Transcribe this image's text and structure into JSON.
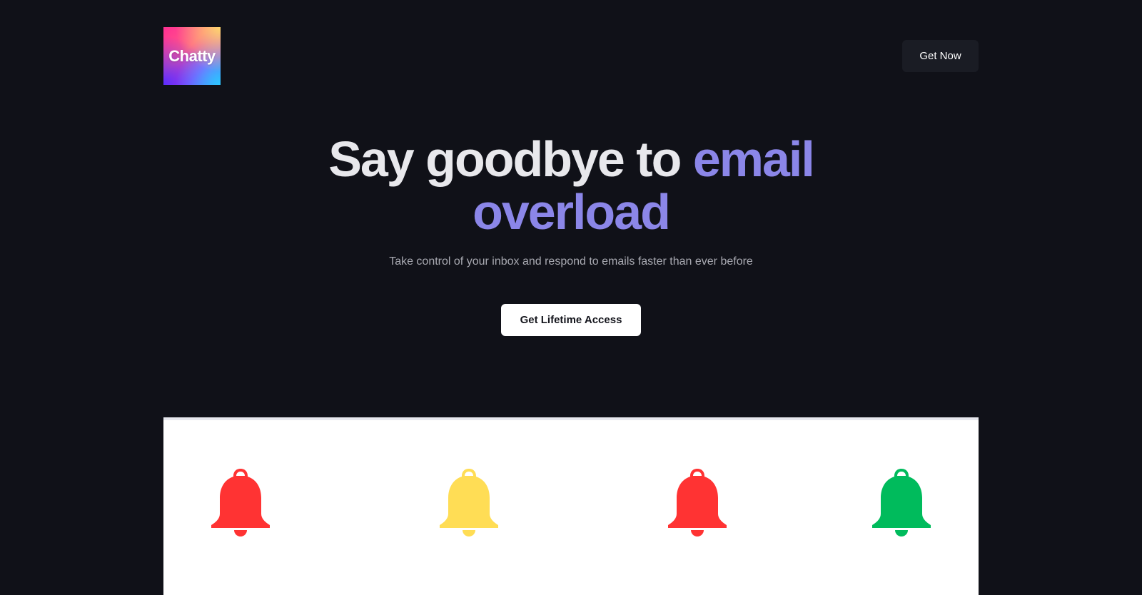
{
  "brand": {
    "logo_text": "Chatty"
  },
  "header": {
    "cta_label": "Get Now"
  },
  "hero": {
    "title_part1": "Say goodbye to ",
    "title_accent": "email overload",
    "subtitle": "Take control of your inbox and respond to emails faster than ever before",
    "cta_label": "Get Lifetime Access"
  },
  "colors": {
    "background": "#101118",
    "accent": "#8b86e8",
    "bell_colors": [
      "#ff3333",
      "#ffdd55",
      "#ff3333",
      "#00bb5c"
    ]
  },
  "panel": {
    "icons": [
      "bell-icon",
      "bell-icon",
      "bell-icon",
      "bell-icon"
    ]
  }
}
